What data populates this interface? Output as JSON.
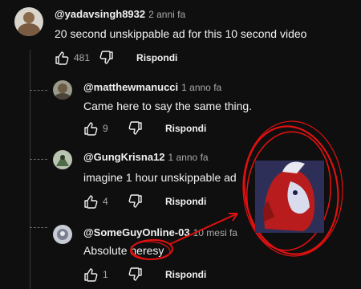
{
  "comments": [
    {
      "author": "@yadavsingh8932",
      "age": "2 anni fa",
      "text": "20 second unskippable ad for this 10 second video",
      "likes": "481",
      "reply": "Rispondi"
    },
    {
      "author": "@matthewmanucci",
      "age": "1 anno fa",
      "text": "Came here to say the same thing.",
      "likes": "9",
      "reply": "Rispondi"
    },
    {
      "author": "@GungKrisna12",
      "age": "1 anno fa",
      "text": "imagine 1 hour unskippable ad",
      "likes": "4",
      "reply": "Rispondi"
    },
    {
      "author": "@SomeGuyOnline-03",
      "age": "10 mesi fa",
      "text_before": "Absolute ",
      "text_highlight": "heresy",
      "likes": "1",
      "reply": "Rispondi"
    }
  ],
  "annotation": {
    "color": "#e01010"
  },
  "icons": {
    "like": "thumb-up-icon",
    "dislike": "thumb-down-icon"
  }
}
